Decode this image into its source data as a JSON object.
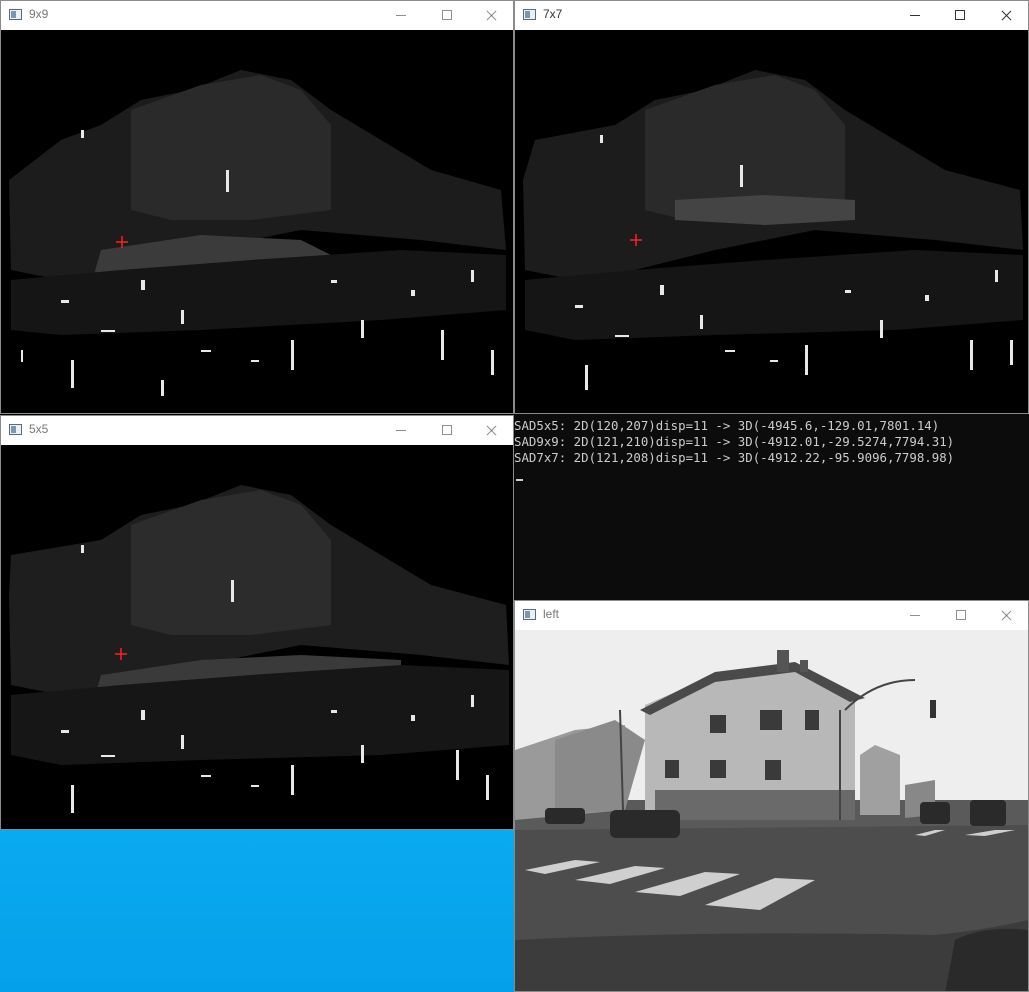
{
  "windows": {
    "w9x9": {
      "title": "9x9"
    },
    "w7x7": {
      "title": "7x7"
    },
    "w5x5": {
      "title": "5x5"
    },
    "left": {
      "title": "left"
    }
  },
  "console": {
    "lines": [
      "SAD5x5: 2D(120,207)disp=11 -> 3D(-4945.6,-129.01,7801.14)",
      "SAD9x9: 2D(121,210)disp=11 -> 3D(-4912.01,-29.5274,7794.31)",
      "SAD7x7: 2D(121,208)disp=11 -> 3D(-4912.22,-95.9096,7798.98)"
    ]
  },
  "colors": {
    "desktop": "#05a0ea",
    "console_bg": "#0c0c0c",
    "marker": "#ff2020"
  },
  "icons": {
    "app": "app-window-icon",
    "minimize": "minimize-icon",
    "maximize": "maximize-icon",
    "close": "close-icon",
    "marker": "crosshair-marker-icon"
  }
}
